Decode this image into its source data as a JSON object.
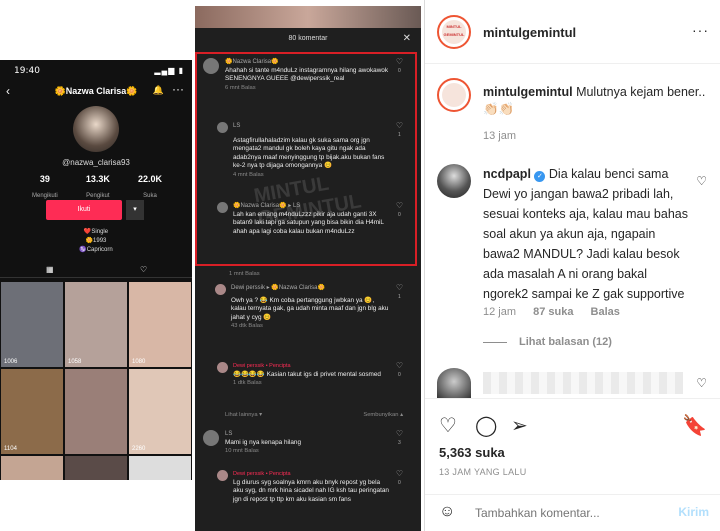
{
  "tiktok": {
    "time": "19:40",
    "name": "🌼Nazwa Clarisa🌼",
    "handle": "@nazwa_clarisa93",
    "stats": [
      {
        "value": "39",
        "label": "Mengikuti"
      },
      {
        "value": "13.3K",
        "label": "Pengikut"
      },
      {
        "value": "22.0K",
        "label": "Suka"
      }
    ],
    "follow_label": "Ikuti",
    "bio": [
      "❤️Single",
      "🌼1993",
      "♑Capricorn"
    ],
    "thumbs": [
      {
        "views": "1006",
        "color": "#6d6f77"
      },
      {
        "views": "1058",
        "color": "#b5a19a"
      },
      {
        "views": "1080",
        "color": "#d8b7a6"
      },
      {
        "views": "1104",
        "color": "#8c6b4a"
      },
      {
        "views": "",
        "color": "#9a7f78"
      },
      {
        "views": "2260",
        "color": "#e0c7b7"
      },
      {
        "views": "",
        "color": "#c4a593"
      },
      {
        "views": "",
        "color": "#5a4b48"
      },
      {
        "views": "",
        "color": "#ddd"
      }
    ]
  },
  "comments_panel": {
    "header": "80 komentar",
    "close": "✕",
    "watermark": "MINTUL GEMINTUL",
    "items": [
      {
        "user": "🌼Nazwa Clarisa🌼",
        "text": "Ahahah si tante m4nduLz instagramnya hilang awokawok SENENGNYA GUEEE @dewiperssik_real",
        "meta": "6 mnt  Balas",
        "likes": "0"
      },
      {
        "user": "LS",
        "text": "Astagfirullahaladzim kalau gk suka sama org jgn mengata2 mandul gk boleh kaya gitu ngak ada adab2nya maaf menyinggung tp bijak.aku bukan fans ke-2 nya tp dijaga omongannya 😊",
        "meta": "4 mnt  Balas",
        "likes": "1"
      },
      {
        "user": "🌼Nazwa Clarisa🌼 ▸ LS",
        "text": "Lah kan emang m4nduLzzz pikir aja udah ganti 3X batan9 laki tapi ga satupun yang bisa bikin dia H4miL ahah apa lagi coba kalau bukan m4nduLzz",
        "meta": "",
        "likes": "0"
      },
      {
        "user": "",
        "text": "",
        "meta": "1 mnt  Balas",
        "likes": ""
      },
      {
        "user": "Dewi perssik ▸ 🌼Nazwa Clarisa🌼",
        "text": "Owh ya ? 😂 Km coba pertanggung jwbkan ya 😊, kalau ternyata gak, ga udah minta maaf dan jgn blg aku jahat y cyg 😊",
        "meta": "43 dtk  Balas",
        "likes": "1"
      },
      {
        "user": "Dewi perssik • Pencipta",
        "text": "😂😂😂😂 Kasian takut igs di privet mental sosmed",
        "meta": "1 dtk  Balas",
        "likes": "0"
      },
      {
        "user": "Lihat lainnya ▾",
        "text": "",
        "meta": "Sembunyikan ▴",
        "likes": ""
      },
      {
        "user": "LS",
        "text": "Mami ig nya kenapa hilang",
        "meta": "10 mnt  Balas",
        "likes": "3"
      },
      {
        "user": "Dewi perssik • Pencipta",
        "text": "Lg diurus syg soalnya kmrn aku bnyk repost yg bela aku syg, dn mrk hina sicadel nah IG ksh tau peringatan jgn di repost tp ttp krn aku kasian sm fans",
        "meta": "",
        "likes": "0"
      }
    ]
  },
  "instagram": {
    "username": "mintulgemintul",
    "avatar_text": "MINTUL GEMINTUL",
    "caption_user": "mintulgemintul",
    "caption_text": "Mulutnya kejam bener..",
    "caption_emoji": "👏🏻👏🏻",
    "caption_time": "13 jam",
    "comment": {
      "user": "ncdpapl",
      "text": "Dia kalau benci sama Dewi yo jangan bawa2 pribadi lah, sesuai konteks aja, kalau mau bahas soal akun ya akun aja, ngapain bawa2 MANDUL? Jadi kalau besok ada masalah A ni orang bakal ngorek2 sampai ke Z gak supportive",
      "time": "12 jam",
      "likes": "87 suka",
      "reply": "Balas",
      "view_replies": "Lihat balasan (12)"
    },
    "likes": "5,363 suka",
    "date": "13 JAM YANG LALU",
    "input_placeholder": "Tambahkan komentar...",
    "post_label": "Kirim"
  }
}
